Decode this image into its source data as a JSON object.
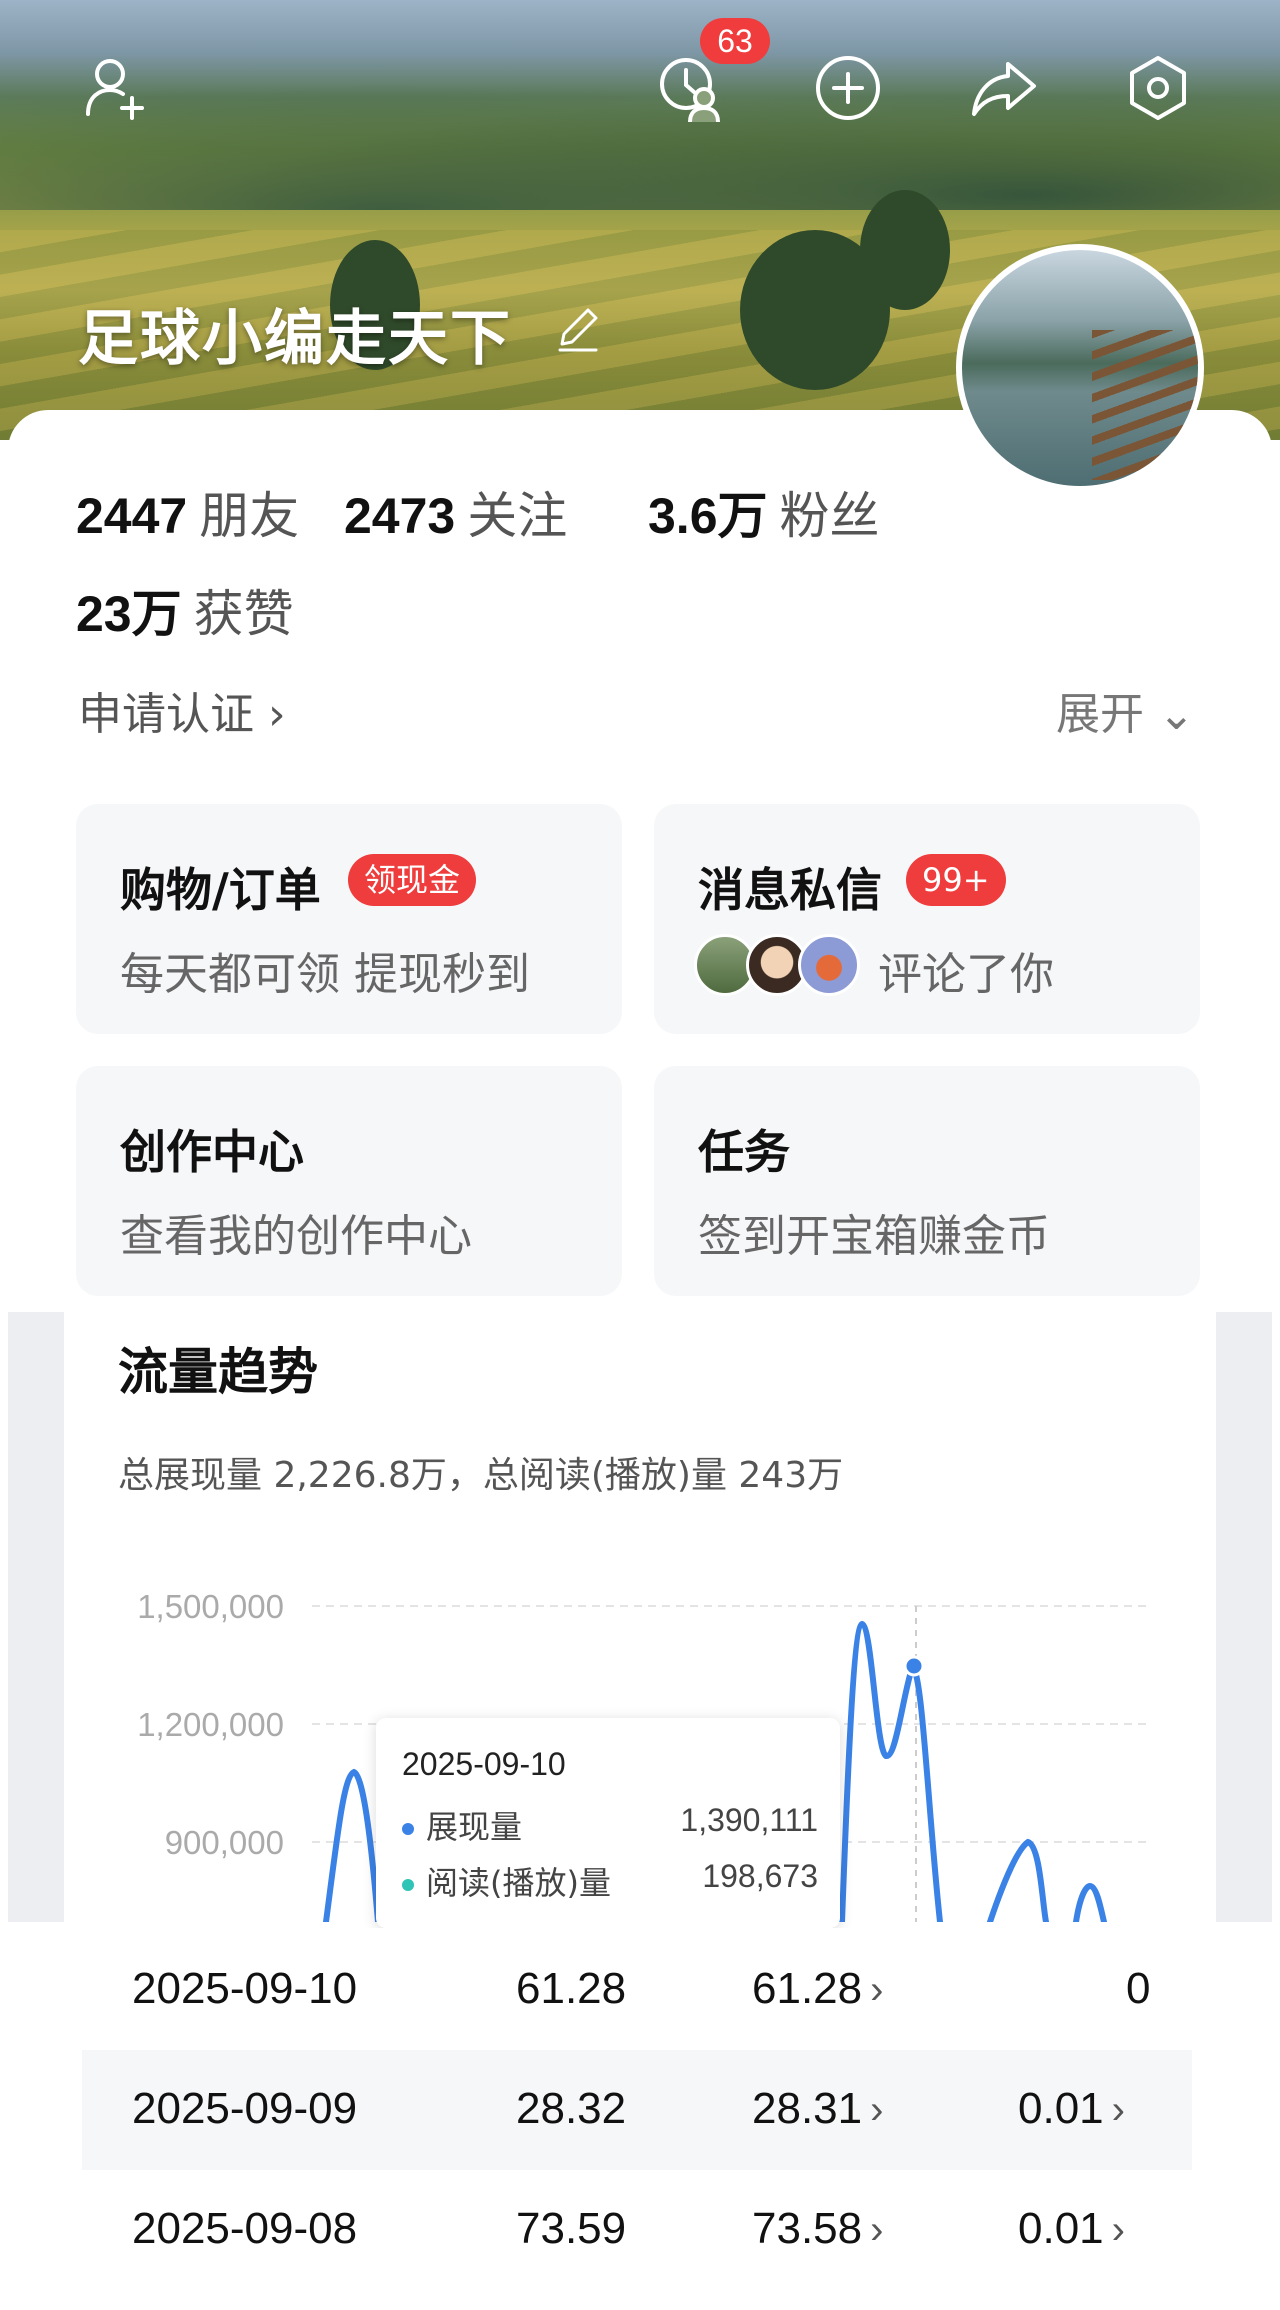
{
  "header": {
    "username": "足球小编走天下",
    "notification_badge": "63"
  },
  "stats": [
    {
      "value": "2447",
      "label": "朋友"
    },
    {
      "value": "2473",
      "label": "关注"
    },
    {
      "value": "3.6万",
      "label": "粉丝"
    },
    {
      "value": "23万",
      "label": "获赞"
    }
  ],
  "profile_actions": {
    "apply_verify": "申请认证 ›",
    "expand": "展开 ⌄"
  },
  "cards": {
    "shopping": {
      "title": "购物/订单",
      "pill": "领现金",
      "sub": "每天都可领 提现秒到"
    },
    "messages": {
      "title": "消息私信",
      "pill": "99+",
      "sub": "评论了你"
    },
    "creator": {
      "title": "创作中心",
      "sub": "查看我的创作中心"
    },
    "tasks": {
      "title": "任务",
      "sub": "签到开宝箱赚金币"
    }
  },
  "traffic": {
    "title": "流量趋势",
    "summary": "总展现量 2,226.8万，总阅读(播放)量 243万"
  },
  "tooltip": {
    "date": "2025-09-10",
    "series1_label": "展现量",
    "series1_value": "1,390,111",
    "series2_label": "阅读(播放)量",
    "series2_value": "198,673"
  },
  "chart_data": {
    "type": "line",
    "y_ticks": [
      "1,500,000",
      "1,200,000",
      "900,000"
    ],
    "ylim": [
      900000,
      1500000
    ],
    "series": [
      {
        "name": "展现量",
        "color": "#3b82e6"
      },
      {
        "name": "阅读(播放)量",
        "color": "#2ec4b6"
      }
    ]
  },
  "table": {
    "rows": [
      {
        "date": "2025-09-10",
        "c1": "61.28",
        "c2": "61.28",
        "c3": "0",
        "c2_arrow": "›",
        "c3_arrow": ""
      },
      {
        "date": "2025-09-09",
        "c1": "28.32",
        "c2": "28.31",
        "c3": "0.01",
        "c2_arrow": "›",
        "c3_arrow": "›"
      },
      {
        "date": "2025-09-08",
        "c1": "73.59",
        "c2": "73.58",
        "c3": "0.01",
        "c2_arrow": "›",
        "c3_arrow": "›"
      }
    ]
  }
}
